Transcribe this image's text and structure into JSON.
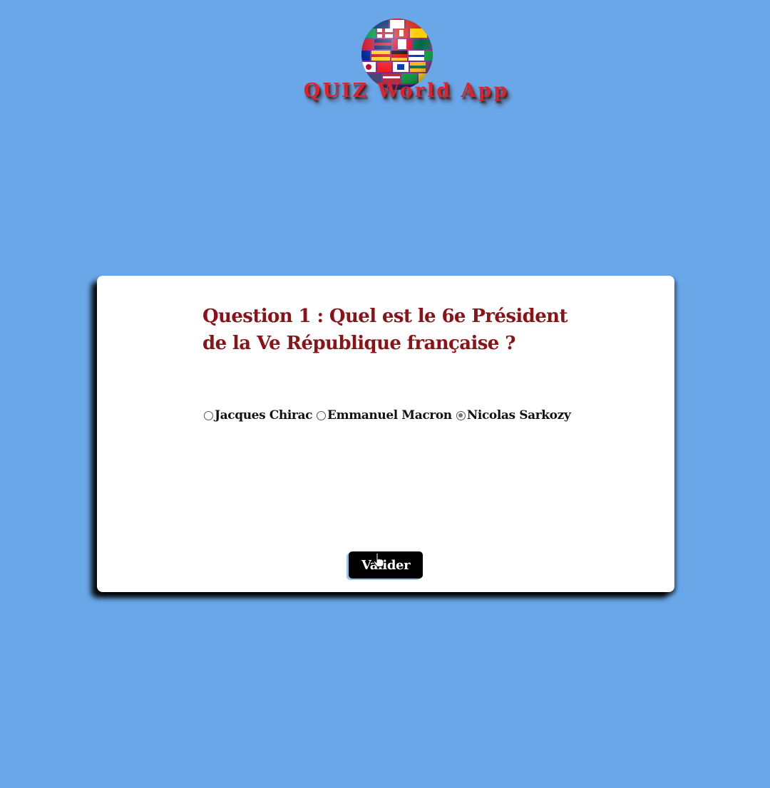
{
  "app": {
    "title": "QUIZ World App",
    "logo_icon": "globe-flags-icon"
  },
  "quiz": {
    "question": "Question 1 : Quel est le 6e Président de la Ve République française ?",
    "answers": [
      {
        "label": "Jacques Chirac",
        "checked": false
      },
      {
        "label": "Emmanuel Macron",
        "checked": false
      },
      {
        "label": "Nicolas Sarkozy",
        "checked": true
      }
    ],
    "submit_label": "Valider"
  },
  "colors": {
    "background": "#6aa7e9",
    "card": "#ffffff",
    "question_text": "#8b1217",
    "title_text": "#e0202c",
    "button": "#000000"
  }
}
